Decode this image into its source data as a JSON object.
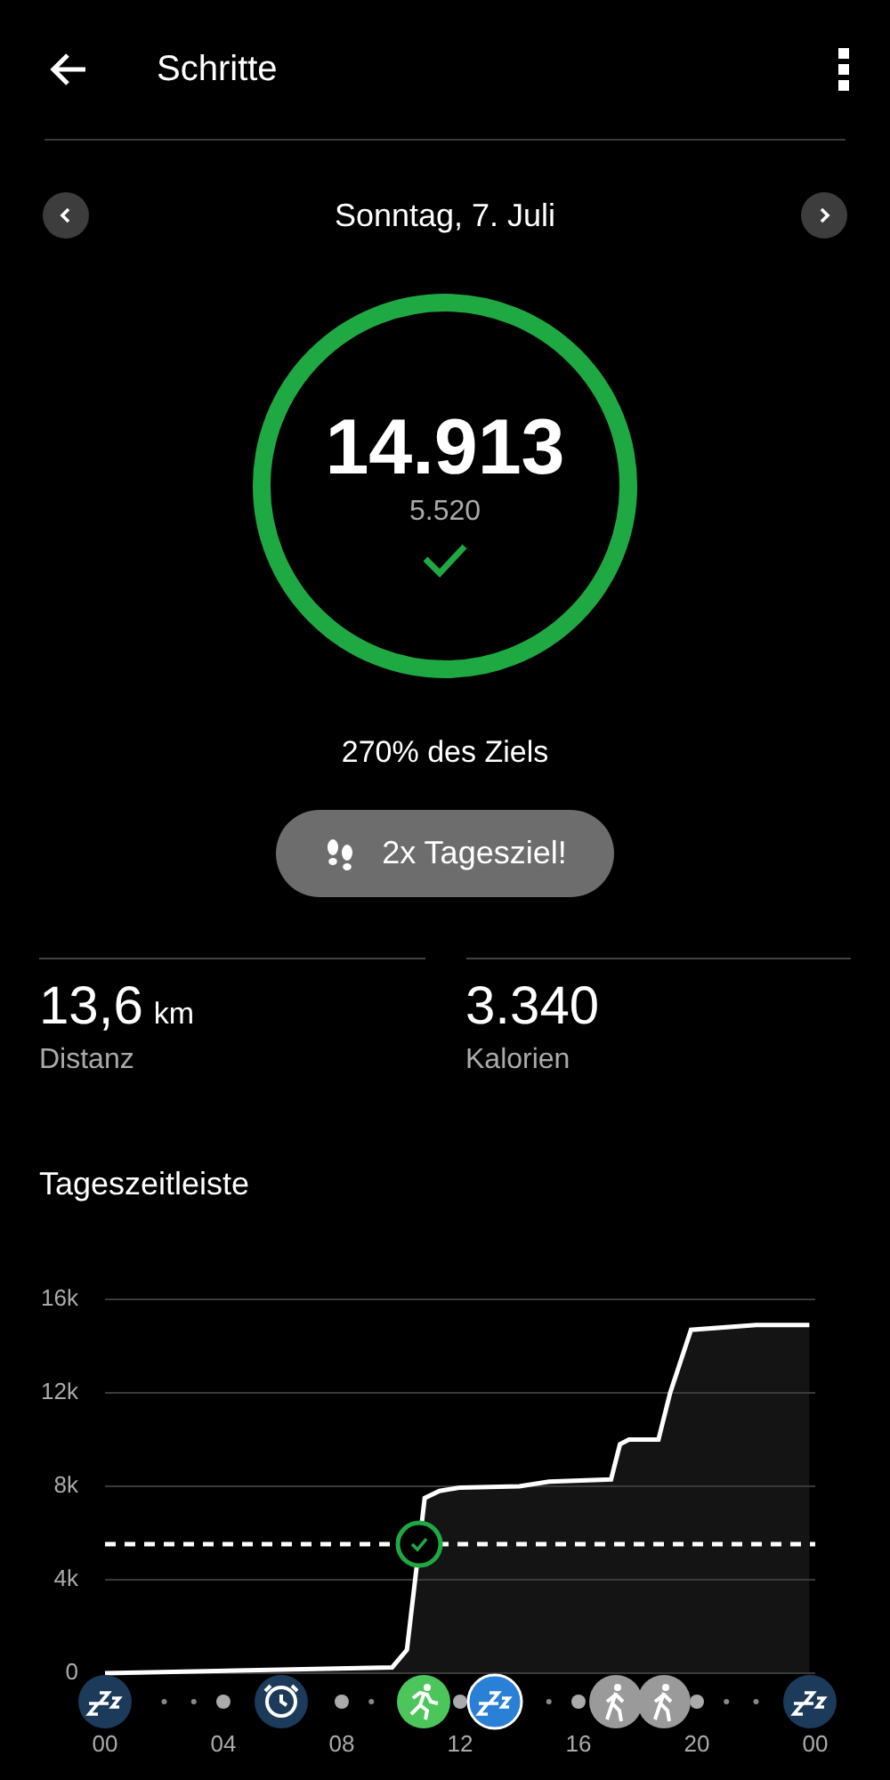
{
  "header": {
    "title": "Schritte"
  },
  "date": {
    "label": "Sonntag, 7. Juli"
  },
  "summary": {
    "steps": "14.913",
    "goal": "5.520",
    "goal_reached": true,
    "percent_text": "270% des Ziels"
  },
  "badge": {
    "label": "2x Tagesziel!"
  },
  "stats": [
    {
      "value": "13,6",
      "unit": "km",
      "label": "Distanz"
    },
    {
      "value": "3.340",
      "label": "Kalorien"
    }
  ],
  "timeline": {
    "title": "Tageszeitleiste",
    "chart_data": {
      "type": "area",
      "grid": true,
      "x": [
        0,
        9.7,
        10.2,
        10.8,
        11.3,
        12,
        14,
        15,
        17.1,
        17.4,
        17.7,
        18.7,
        19.1,
        19.8,
        22,
        23.8
      ],
      "series": [
        {
          "color": "#ffffff",
          "values": [
            0,
            250,
            1000,
            7500,
            7800,
            7950,
            8000,
            8200,
            8300,
            9800,
            10000,
            10000,
            12000,
            14700,
            14900,
            14900
          ]
        }
      ],
      "xlim": [
        0,
        24
      ],
      "ylim": [
        0,
        16000
      ],
      "xticks": [
        {
          "value": 0,
          "label": "00"
        },
        {
          "value": 4,
          "label": "04"
        },
        {
          "value": 8,
          "label": "08"
        },
        {
          "value": 12,
          "label": "12"
        },
        {
          "value": 16,
          "label": "16"
        },
        {
          "value": 20,
          "label": "20"
        },
        {
          "value": 24,
          "label": "00"
        }
      ],
      "yticks": [
        {
          "value": 0,
          "label": "0"
        },
        {
          "value": 4000,
          "label": "4k"
        },
        {
          "value": 8000,
          "label": "8k"
        },
        {
          "value": 12000,
          "label": "12k"
        },
        {
          "value": 16000,
          "label": "16k"
        }
      ],
      "ref_lines": [
        {
          "axis": "y",
          "value": 5520
        }
      ]
    },
    "events": [
      {
        "kind": "sleep",
        "color": "#1c3a5a"
      },
      {
        "kind": "alarm",
        "color": "#1c3a5a"
      },
      {
        "kind": "run",
        "color": "#4cc65a"
      },
      {
        "kind": "sleep",
        "color": "#2a7fd6"
      },
      {
        "kind": "walk",
        "color": "#9a9a9a"
      },
      {
        "kind": "walk",
        "color": "#9a9a9a"
      },
      {
        "kind": "sleep",
        "color": "#1c3a5a"
      }
    ]
  }
}
